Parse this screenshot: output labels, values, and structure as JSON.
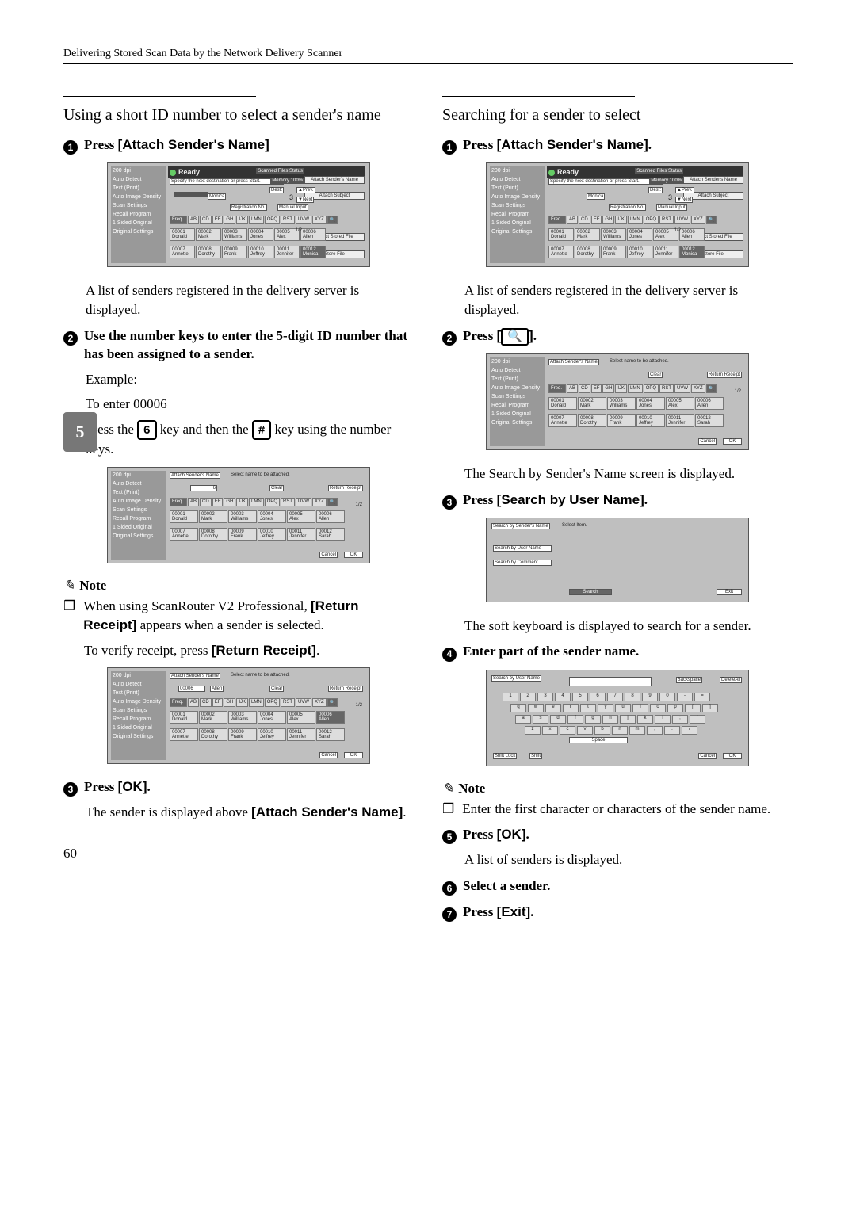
{
  "running_head": "Delivering Stored Scan Data by the Network Delivery Scanner",
  "left_tab": "5",
  "page_number": "60",
  "left": {
    "section_title": "Using a short ID number to select a sender's name",
    "step1": {
      "label": "Press",
      "button": "[Attach Sender's Name]"
    },
    "after_step1": "A list of senders registered in the delivery server is displayed.",
    "step2": "Use the number keys to enter the 5-digit ID number that has been assigned to a sender.",
    "example_label": "Example:",
    "example_intro": "To enter 00006",
    "example_body_a": "Press the",
    "example_key1": "6",
    "example_body_b": "key and then the",
    "example_key2": "#",
    "example_body_c": "key using the number keys.",
    "note_head": "Note",
    "note1_a": "When using ScanRouter V2 Professional,",
    "note1_btn": "[Return Receipt]",
    "note1_b": "appears when a sender is selected.",
    "note2_a": "To verify receipt, press",
    "note2_btn": "[Return Receipt]",
    "note2_b": ".",
    "step3_label": "Press",
    "step3_btn": "[OK]",
    "step3_tail": ".",
    "step3_body_a": "The sender is displayed above",
    "step3_body_btn": "[Attach Sender's Name]",
    "step3_body_b": "."
  },
  "right": {
    "section_title": "Searching for a sender to select",
    "step1_label": "Press",
    "step1_btn": "[Attach Sender's Name]",
    "step1_tail": ".",
    "after_step1": "A list of senders registered in the delivery server is displayed.",
    "step2_label": "Press",
    "step2_btn": "[🔍]",
    "step2_tail": ".",
    "after_step2": "The Search by Sender's Name screen is displayed.",
    "step3_label": "Press",
    "step3_btn": "[Search by User Name]",
    "step3_tail": ".",
    "after_step3": "The soft keyboard is displayed to search for a sender.",
    "step4": "Enter part of the sender name.",
    "note_head": "Note",
    "note1": "Enter the first character or characters of the sender name.",
    "step5_label": "Press",
    "step5_btn": "[OK]",
    "step5_tail": ".",
    "after_step5": "A list of senders is displayed.",
    "step6": "Select a sender.",
    "step7_label": "Press",
    "step7_btn": "[Exit]",
    "step7_tail": "."
  },
  "panel": {
    "ready": "Ready",
    "dest_hint": "Specify the next destination or press Start.",
    "scanned_status": "Scanned Files Status",
    "memory": "Memory 100%",
    "dest_label": "Dest:",
    "dest_count": "3",
    "prev": "▲Prev.",
    "next": "▼Next",
    "attach_sender": "Attach Sender's Name",
    "attach_subject": "Attach Subject",
    "select_stored": "Select Stored File",
    "store_file": "Store File",
    "reg_no": "Registration No.",
    "manual_input": "Manual Input",
    "pager": "1/2",
    "sidebar": [
      "200 dpi",
      "Auto Detect",
      "Text (Print)",
      "Auto Image Density",
      "Scan Settings",
      "Recall Program",
      "1 Sided Original",
      "Original Settings"
    ],
    "thumb": "Monica",
    "index": [
      "Freq.",
      "AB",
      "CD",
      "EF",
      "GH",
      "IJK",
      "LMN",
      "OPQ",
      "RST",
      "UVW",
      "XYZ",
      "🔍"
    ],
    "row1": [
      {
        "id": "00001",
        "n": "Donald"
      },
      {
        "id": "00002",
        "n": "Mark"
      },
      {
        "id": "00003",
        "n": "Williams"
      },
      {
        "id": "00004",
        "n": "Jones"
      },
      {
        "id": "00005",
        "n": "Alex"
      },
      {
        "id": "00006",
        "n": "Allen"
      }
    ],
    "row2": [
      {
        "id": "00007",
        "n": "Annette"
      },
      {
        "id": "00008",
        "n": "Dorothy"
      },
      {
        "id": "00009",
        "n": "Frank"
      },
      {
        "id": "00010",
        "n": "Jeffrey"
      },
      {
        "id": "00011",
        "n": "Jennifer"
      },
      {
        "id": "00012",
        "n": "Monica"
      }
    ]
  },
  "sender_screen": {
    "title": "Attach Sender's Name",
    "hint": "Select name to be attached.",
    "input6": "6",
    "input_full": "00006",
    "result_name": "Allen",
    "clear": "Clear",
    "return_receipt": "Return Receipt",
    "cancel": "Cancel",
    "ok": "OK",
    "row2_extra": [
      {
        "id": "00011",
        "n": "Jennifer"
      },
      {
        "id": "00012",
        "n": "Sarah"
      }
    ]
  },
  "search_screen": {
    "title_sender": "Search by Sender's Name",
    "title_user": "Search by User Name",
    "hint": "Select Item.",
    "btn_user": "Search by User Name",
    "btn_comment": "Search by Comment",
    "search": "Search",
    "exit": "Exit"
  },
  "kb_screen": {
    "backspace": "Backspace",
    "delete_all": "DeleteAll",
    "shift_lock": "Shift Lock",
    "shift": "Shift",
    "space": "Space",
    "cancel": "Cancel",
    "ok": "OK",
    "row_num": [
      "1",
      "2",
      "3",
      "4",
      "5",
      "6",
      "7",
      "8",
      "9",
      "0",
      "-",
      "="
    ],
    "row_q": [
      "q",
      "w",
      "e",
      "r",
      "t",
      "y",
      "u",
      "i",
      "o",
      "p",
      "[",
      "]"
    ],
    "row_a": [
      "a",
      "s",
      "d",
      "f",
      "g",
      "h",
      "j",
      "k",
      "l",
      ";",
      "'"
    ],
    "row_z": [
      "z",
      "x",
      "c",
      "v",
      "b",
      "n",
      "m",
      ",",
      ".",
      "/"
    ]
  }
}
